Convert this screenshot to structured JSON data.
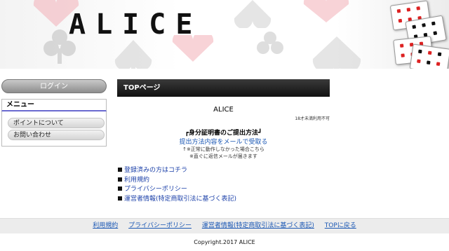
{
  "header": {
    "logo_text": "ALICE"
  },
  "sidebar": {
    "login_label": "ログイン",
    "menu_title": "メニュー",
    "items": [
      {
        "label": "ポイントについて"
      },
      {
        "label": "お問い合わせ"
      }
    ]
  },
  "main": {
    "section_title": "TOPページ",
    "site_name": "ALICE",
    "age_notice": "18才未満利用不可",
    "id_title": "┏身分証明書のご提出方法┛",
    "id_link": "提出方法内容をメールで受取る",
    "note1": "↑※正常に動作しなかった場合こちら",
    "note2": "※直ぐに返信メールが届きます",
    "links": [
      {
        "label": "登録済みの方はコチラ"
      },
      {
        "label": "利用規約"
      },
      {
        "label": "プライバシーポリシー"
      },
      {
        "label": "運営者情報(特定商取引法に基づく表記)"
      }
    ]
  },
  "footer": {
    "links": [
      {
        "label": "利用規約"
      },
      {
        "label": "プライバシーポリシー"
      },
      {
        "label": "運営者情報(特定商取引法に基づく表記)"
      },
      {
        "label": "TOPに戻る"
      }
    ],
    "copyright": "Copyright.2017 ALICE"
  },
  "colors": {
    "link": "#1a57b4",
    "title_bar": "#111111",
    "heart": "#f3b0b8",
    "spade": "#c9c9c9"
  }
}
